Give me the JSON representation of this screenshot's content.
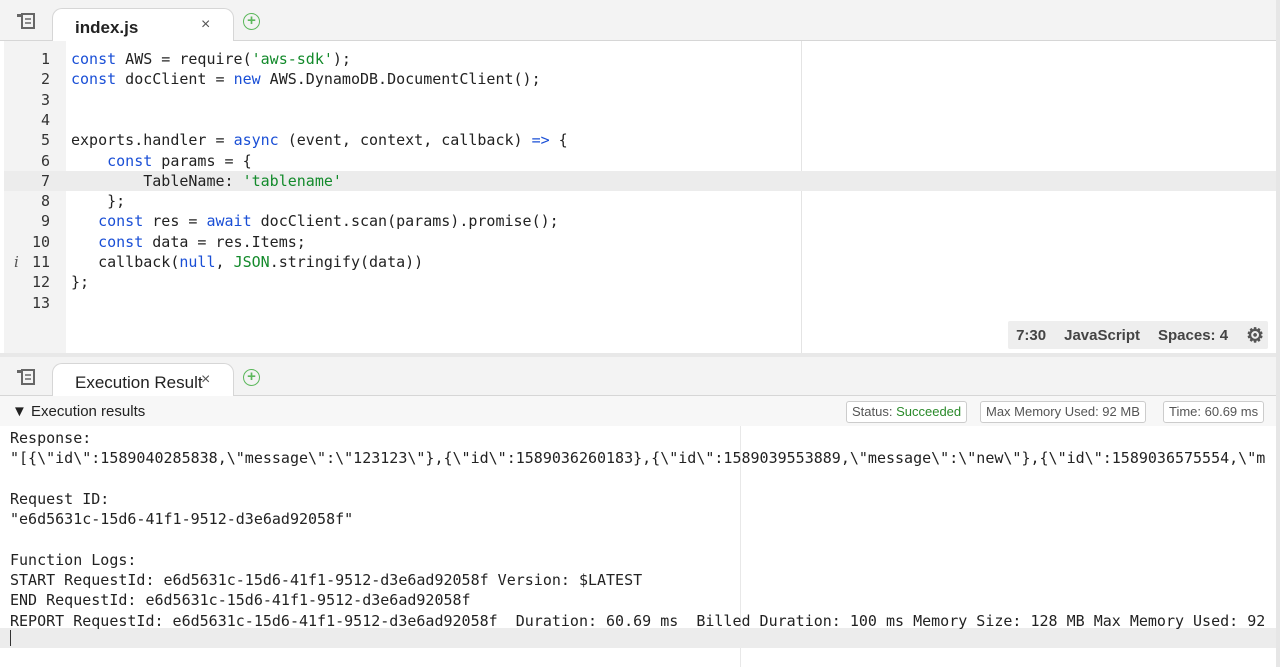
{
  "editor": {
    "tab_label": "index.js",
    "close_glyph": "×",
    "add_glyph": "+",
    "lines": [
      {
        "num": "1",
        "tokens": [
          {
            "t": "kw",
            "v": "const"
          },
          {
            "t": "",
            "v": " AWS = require("
          },
          {
            "t": "str",
            "v": "'aws-sdk'"
          },
          {
            "t": "",
            "v": ");"
          }
        ]
      },
      {
        "num": "2",
        "tokens": [
          {
            "t": "kw",
            "v": "const"
          },
          {
            "t": "",
            "v": " docClient = "
          },
          {
            "t": "kw",
            "v": "new"
          },
          {
            "t": "",
            "v": " AWS.DynamoDB.DocumentClient();"
          }
        ]
      },
      {
        "num": "3",
        "tokens": []
      },
      {
        "num": "4",
        "tokens": []
      },
      {
        "num": "5",
        "tokens": [
          {
            "t": "",
            "v": "exports.handler = "
          },
          {
            "t": "kw",
            "v": "async"
          },
          {
            "t": "",
            "v": " (event, context, callback) "
          },
          {
            "t": "kw",
            "v": "=>"
          },
          {
            "t": "",
            "v": " {"
          }
        ]
      },
      {
        "num": "6",
        "tokens": [
          {
            "t": "",
            "v": "    "
          },
          {
            "t": "kw",
            "v": "const"
          },
          {
            "t": "",
            "v": " params = {"
          }
        ]
      },
      {
        "num": "7",
        "active": true,
        "tokens": [
          {
            "t": "",
            "v": "        TableName: "
          },
          {
            "t": "str",
            "v": "'tablename'"
          }
        ]
      },
      {
        "num": "8",
        "tokens": [
          {
            "t": "",
            "v": "    };"
          }
        ]
      },
      {
        "num": "9",
        "tokens": [
          {
            "t": "",
            "v": "   "
          },
          {
            "t": "kw",
            "v": "const"
          },
          {
            "t": "",
            "v": " res = "
          },
          {
            "t": "kw",
            "v": "await"
          },
          {
            "t": "",
            "v": " docClient.scan(params).promise();"
          }
        ]
      },
      {
        "num": "10",
        "tokens": [
          {
            "t": "",
            "v": "   "
          },
          {
            "t": "kw",
            "v": "const"
          },
          {
            "t": "",
            "v": " data = res.Items;"
          }
        ]
      },
      {
        "num": "11",
        "info": "i",
        "tokens": [
          {
            "t": "",
            "v": "   callback("
          },
          {
            "t": "nl",
            "v": "null"
          },
          {
            "t": "",
            "v": ", "
          },
          {
            "t": "str",
            "v": "JSON"
          },
          {
            "t": "",
            "v": ".stringify(data))"
          }
        ]
      },
      {
        "num": "12",
        "tokens": [
          {
            "t": "",
            "v": "};"
          }
        ]
      },
      {
        "num": "13",
        "tokens": []
      }
    ],
    "status": {
      "cursor": "7:30",
      "language": "JavaScript",
      "spaces": "Spaces: 4",
      "gear": "⚙"
    }
  },
  "results_panel": {
    "tab_label": "Execution Result",
    "close_glyph": "×",
    "add_glyph": "+",
    "section_toggle": "▼ Execution results",
    "status_prefix": "Status: ",
    "status_value": "Succeeded",
    "max_memory": "Max Memory Used: 92 MB",
    "time": "Time: 60.69 ms",
    "lines": [
      "Response:",
      "\"[{\\\"id\\\":1589040285838,\\\"message\\\":\\\"123123\\\"},{\\\"id\\\":1589036260183},{\\\"id\\\":1589039553889,\\\"message\\\":\\\"new\\\"},{\\\"id\\\":1589036575554,\\\"m",
      "",
      "Request ID:",
      "\"e6d5631c-15d6-41f1-9512-d3e6ad92058f\"",
      "",
      "Function Logs:",
      "START RequestId: e6d5631c-15d6-41f1-9512-d3e6ad92058f Version: $LATEST",
      "END RequestId: e6d5631c-15d6-41f1-9512-d3e6ad92058f",
      "REPORT RequestId: e6d5631c-15d6-41f1-9512-d3e6ad92058f  Duration: 60.69 ms  Billed Duration: 100 ms Memory Size: 128 MB Max Memory Used: 92"
    ]
  }
}
